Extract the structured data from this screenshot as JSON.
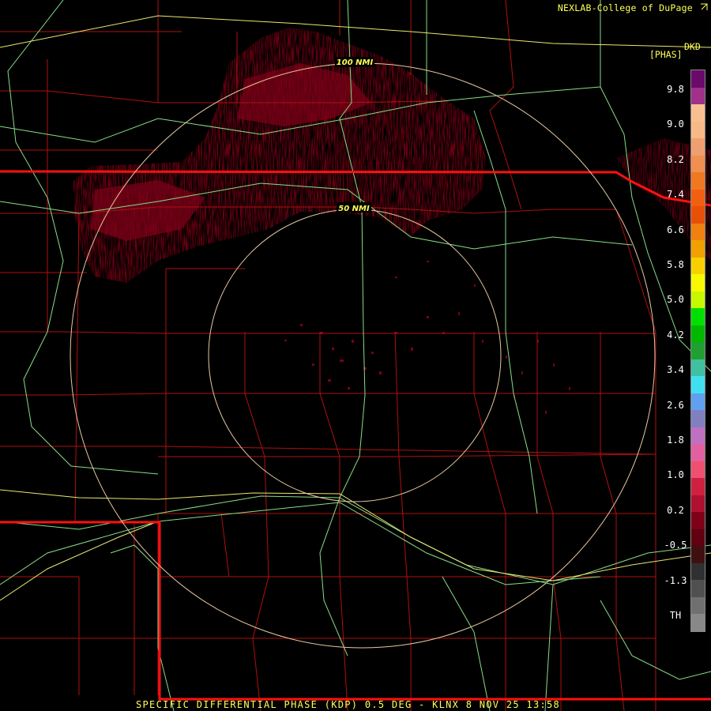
{
  "credit": {
    "text": "NEXLAB-College of DuPage",
    "icon": "external-link-icon"
  },
  "legend": {
    "product": "DKD",
    "units": "[PHAS]",
    "labels": [
      "9.8",
      "9.0",
      "8.2",
      "7.4",
      "6.6",
      "5.8",
      "5.0",
      "4.2",
      "3.4",
      "2.6",
      "1.8",
      "1.0",
      "0.2",
      "-0.5",
      "-1.3",
      "TH"
    ],
    "colors": [
      "#6a0a6a",
      "#a0308a",
      "#f8c090",
      "#f8b888",
      "#f0a070",
      "#f09050",
      "#f07820",
      "#f06010",
      "#e85008",
      "#f08010",
      "#f0a000",
      "#f8d000",
      "#f8f800",
      "#c8f800",
      "#00e000",
      "#00b800",
      "#20a030",
      "#40c0a0",
      "#40e0f0",
      "#60a0f0",
      "#8080c0",
      "#c070c0",
      "#e060a0",
      "#f05070",
      "#d02040",
      "#b01030",
      "#800018",
      "#600010",
      "#401010",
      "#303030",
      "#505050",
      "#707070",
      "#888888"
    ],
    "colors_note": "colorbar"
  },
  "rings": {
    "inner": "50 NMI",
    "outer": "100 NMI"
  },
  "footer": {
    "text": "SPECIFIC DIFFERENTIAL PHASE (KDP) 0.5 DEG - KLNX 8 NOV 25 13:58"
  }
}
